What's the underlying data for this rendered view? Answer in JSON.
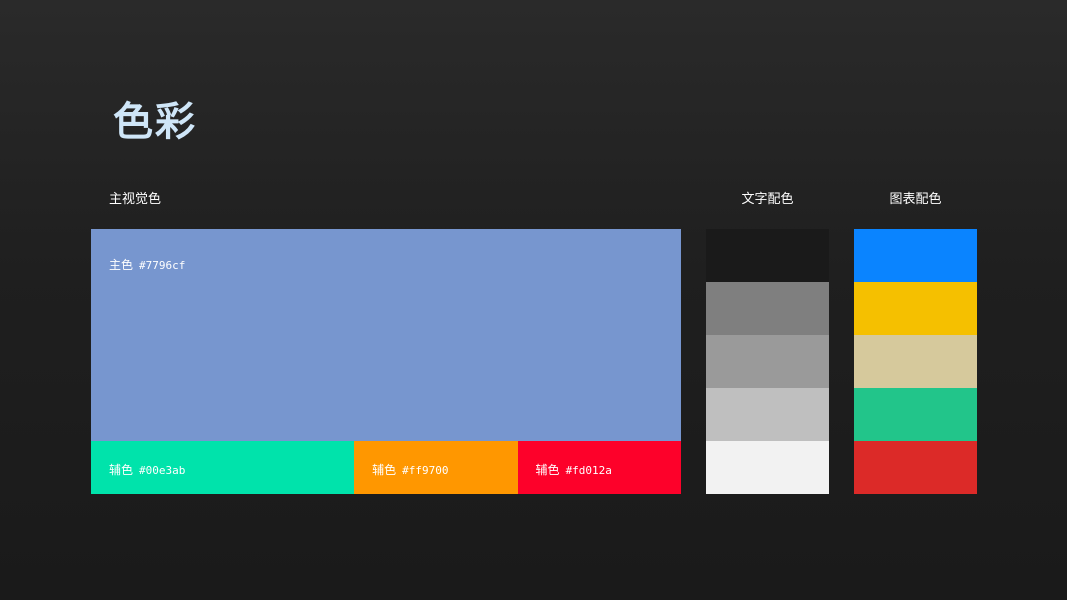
{
  "title": "色彩",
  "main_visual": {
    "label": "主视觉色",
    "primary": {
      "name": "主色",
      "hex": "#7796cf"
    },
    "secondary": [
      {
        "name": "辅色",
        "hex": "#00e3ab",
        "share": 0.446
      },
      {
        "name": "辅色",
        "hex": "#ff9700",
        "share": 0.277
      },
      {
        "name": "辅色",
        "hex": "#fd012a",
        "share": 0.277
      }
    ]
  },
  "text_colors": {
    "label": "文字配色",
    "swatches": [
      "#1a1a1a",
      "#7f7f7f",
      "#9a9a9a",
      "#bfbfbf",
      "#f2f2f2"
    ]
  },
  "chart_colors": {
    "label": "图表配色",
    "swatches": [
      "#0a84ff",
      "#f5c000",
      "#d6c99c",
      "#22c58a",
      "#dc2a28"
    ]
  }
}
